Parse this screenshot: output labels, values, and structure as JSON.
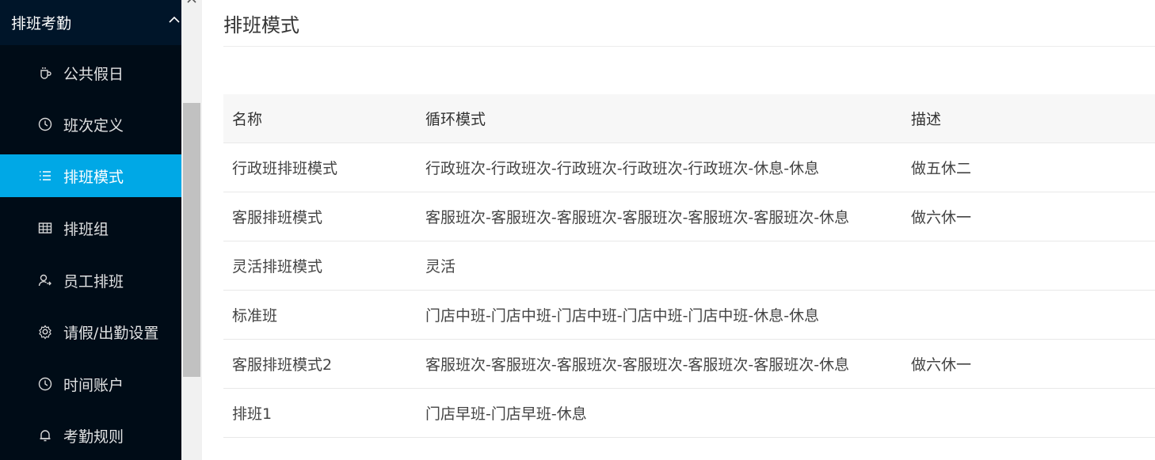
{
  "sidebar": {
    "group_title": "排班考勤",
    "items": [
      {
        "label": "公共假日",
        "icon": "coffee-cup-icon"
      },
      {
        "label": "班次定义",
        "icon": "clock-icon"
      },
      {
        "label": "排班模式",
        "icon": "list-icon",
        "active": true
      },
      {
        "label": "排班组",
        "icon": "table-grid-icon"
      },
      {
        "label": "员工排班",
        "icon": "user-switch-icon"
      },
      {
        "label": "请假/出勤设置",
        "icon": "gear-icon"
      },
      {
        "label": "时间账户",
        "icon": "clock-icon"
      },
      {
        "label": "考勤规则",
        "icon": "bell-icon"
      }
    ]
  },
  "main": {
    "title": "排班模式",
    "table": {
      "columns": [
        "名称",
        "循环模式",
        "描述"
      ],
      "rows": [
        [
          "行政班排班模式",
          "行政班次-行政班次-行政班次-行政班次-行政班次-休息-休息",
          "做五休二"
        ],
        [
          "客服排班模式",
          "客服班次-客服班次-客服班次-客服班次-客服班次-客服班次-休息",
          "做六休一"
        ],
        [
          "灵活排班模式",
          "灵活",
          ""
        ],
        [
          "标准班",
          "门店中班-门店中班-门店中班-门店中班-门店中班-休息-休息",
          ""
        ],
        [
          "客服排班模式2",
          "客服班次-客服班次-客服班次-客服班次-客服班次-客服班次-休息",
          "做六休一"
        ],
        [
          "排班1",
          "门店早班-门店早班-休息",
          ""
        ]
      ]
    }
  },
  "colors": {
    "sidebar_bg": "#000c17",
    "group_header_bg": "#001529",
    "active_item_bg": "#00a8e6"
  }
}
